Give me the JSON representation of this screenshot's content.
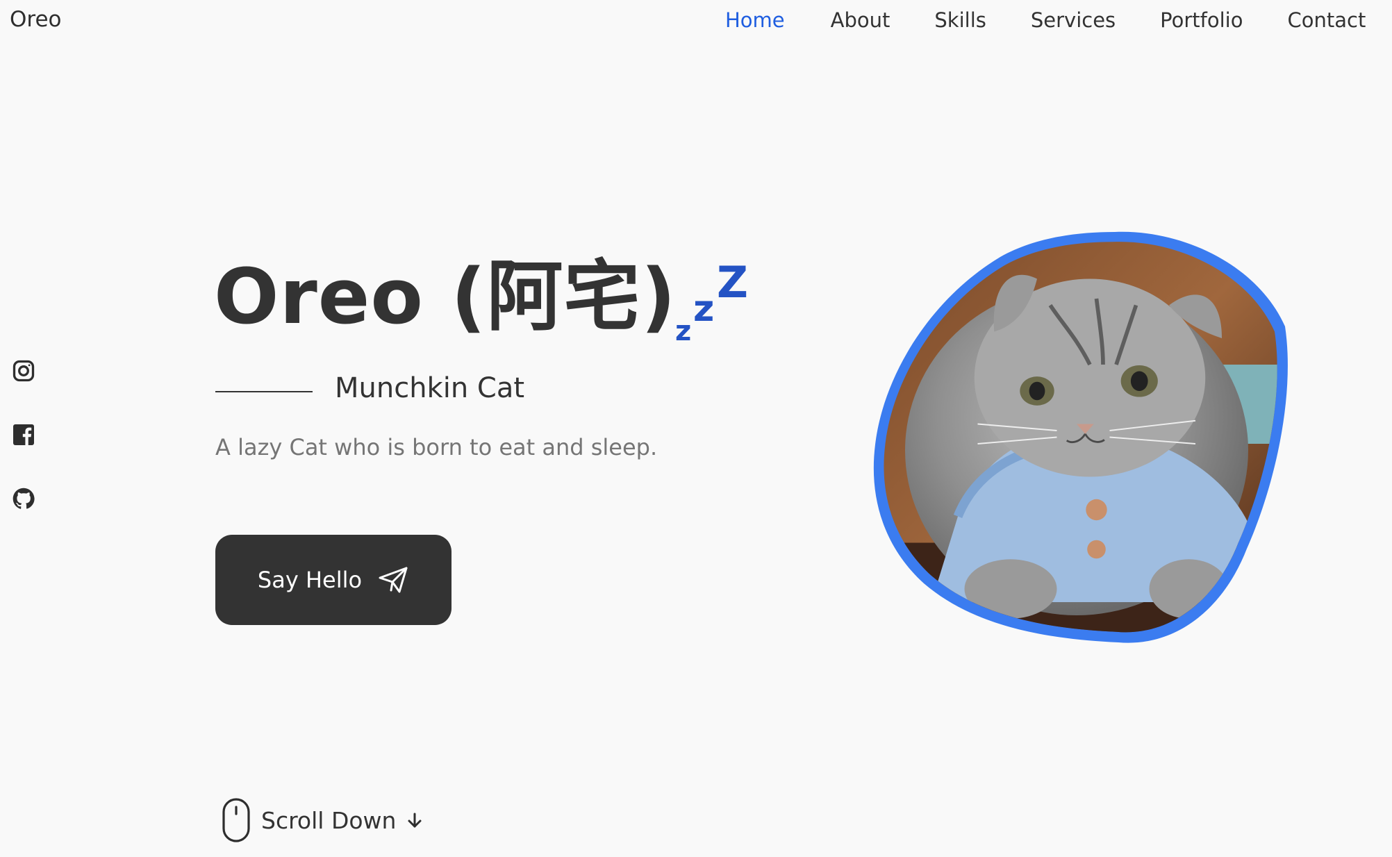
{
  "header": {
    "logo": "Oreo",
    "nav": [
      {
        "label": "Home",
        "active": true
      },
      {
        "label": "About",
        "active": false
      },
      {
        "label": "Skills",
        "active": false
      },
      {
        "label": "Services",
        "active": false
      },
      {
        "label": "Portfolio",
        "active": false
      },
      {
        "label": "Contact",
        "active": false
      }
    ]
  },
  "social": [
    {
      "icon": "instagram-icon"
    },
    {
      "icon": "facebook-icon"
    },
    {
      "icon": "github-icon"
    }
  ],
  "hero": {
    "title": "Oreo (阿宅)",
    "title_icon": "sleeping-zzz-icon",
    "subtitle": "Munchkin Cat",
    "description": "A lazy Cat who is born to eat and sleep.",
    "button_label": "Say Hello",
    "button_icon": "send-icon",
    "scroll_label": "Scroll Down",
    "scroll_icons": [
      "mouse-icon",
      "arrow-down-icon"
    ],
    "image_icon": "cat-photo"
  },
  "colors": {
    "accent": "#1f5ee0",
    "blob_border": "#3b7cf0",
    "zzz": "#2453c4",
    "text": "#333333",
    "muted": "#757575",
    "background": "#f9f9f9",
    "button_bg": "#333333"
  }
}
